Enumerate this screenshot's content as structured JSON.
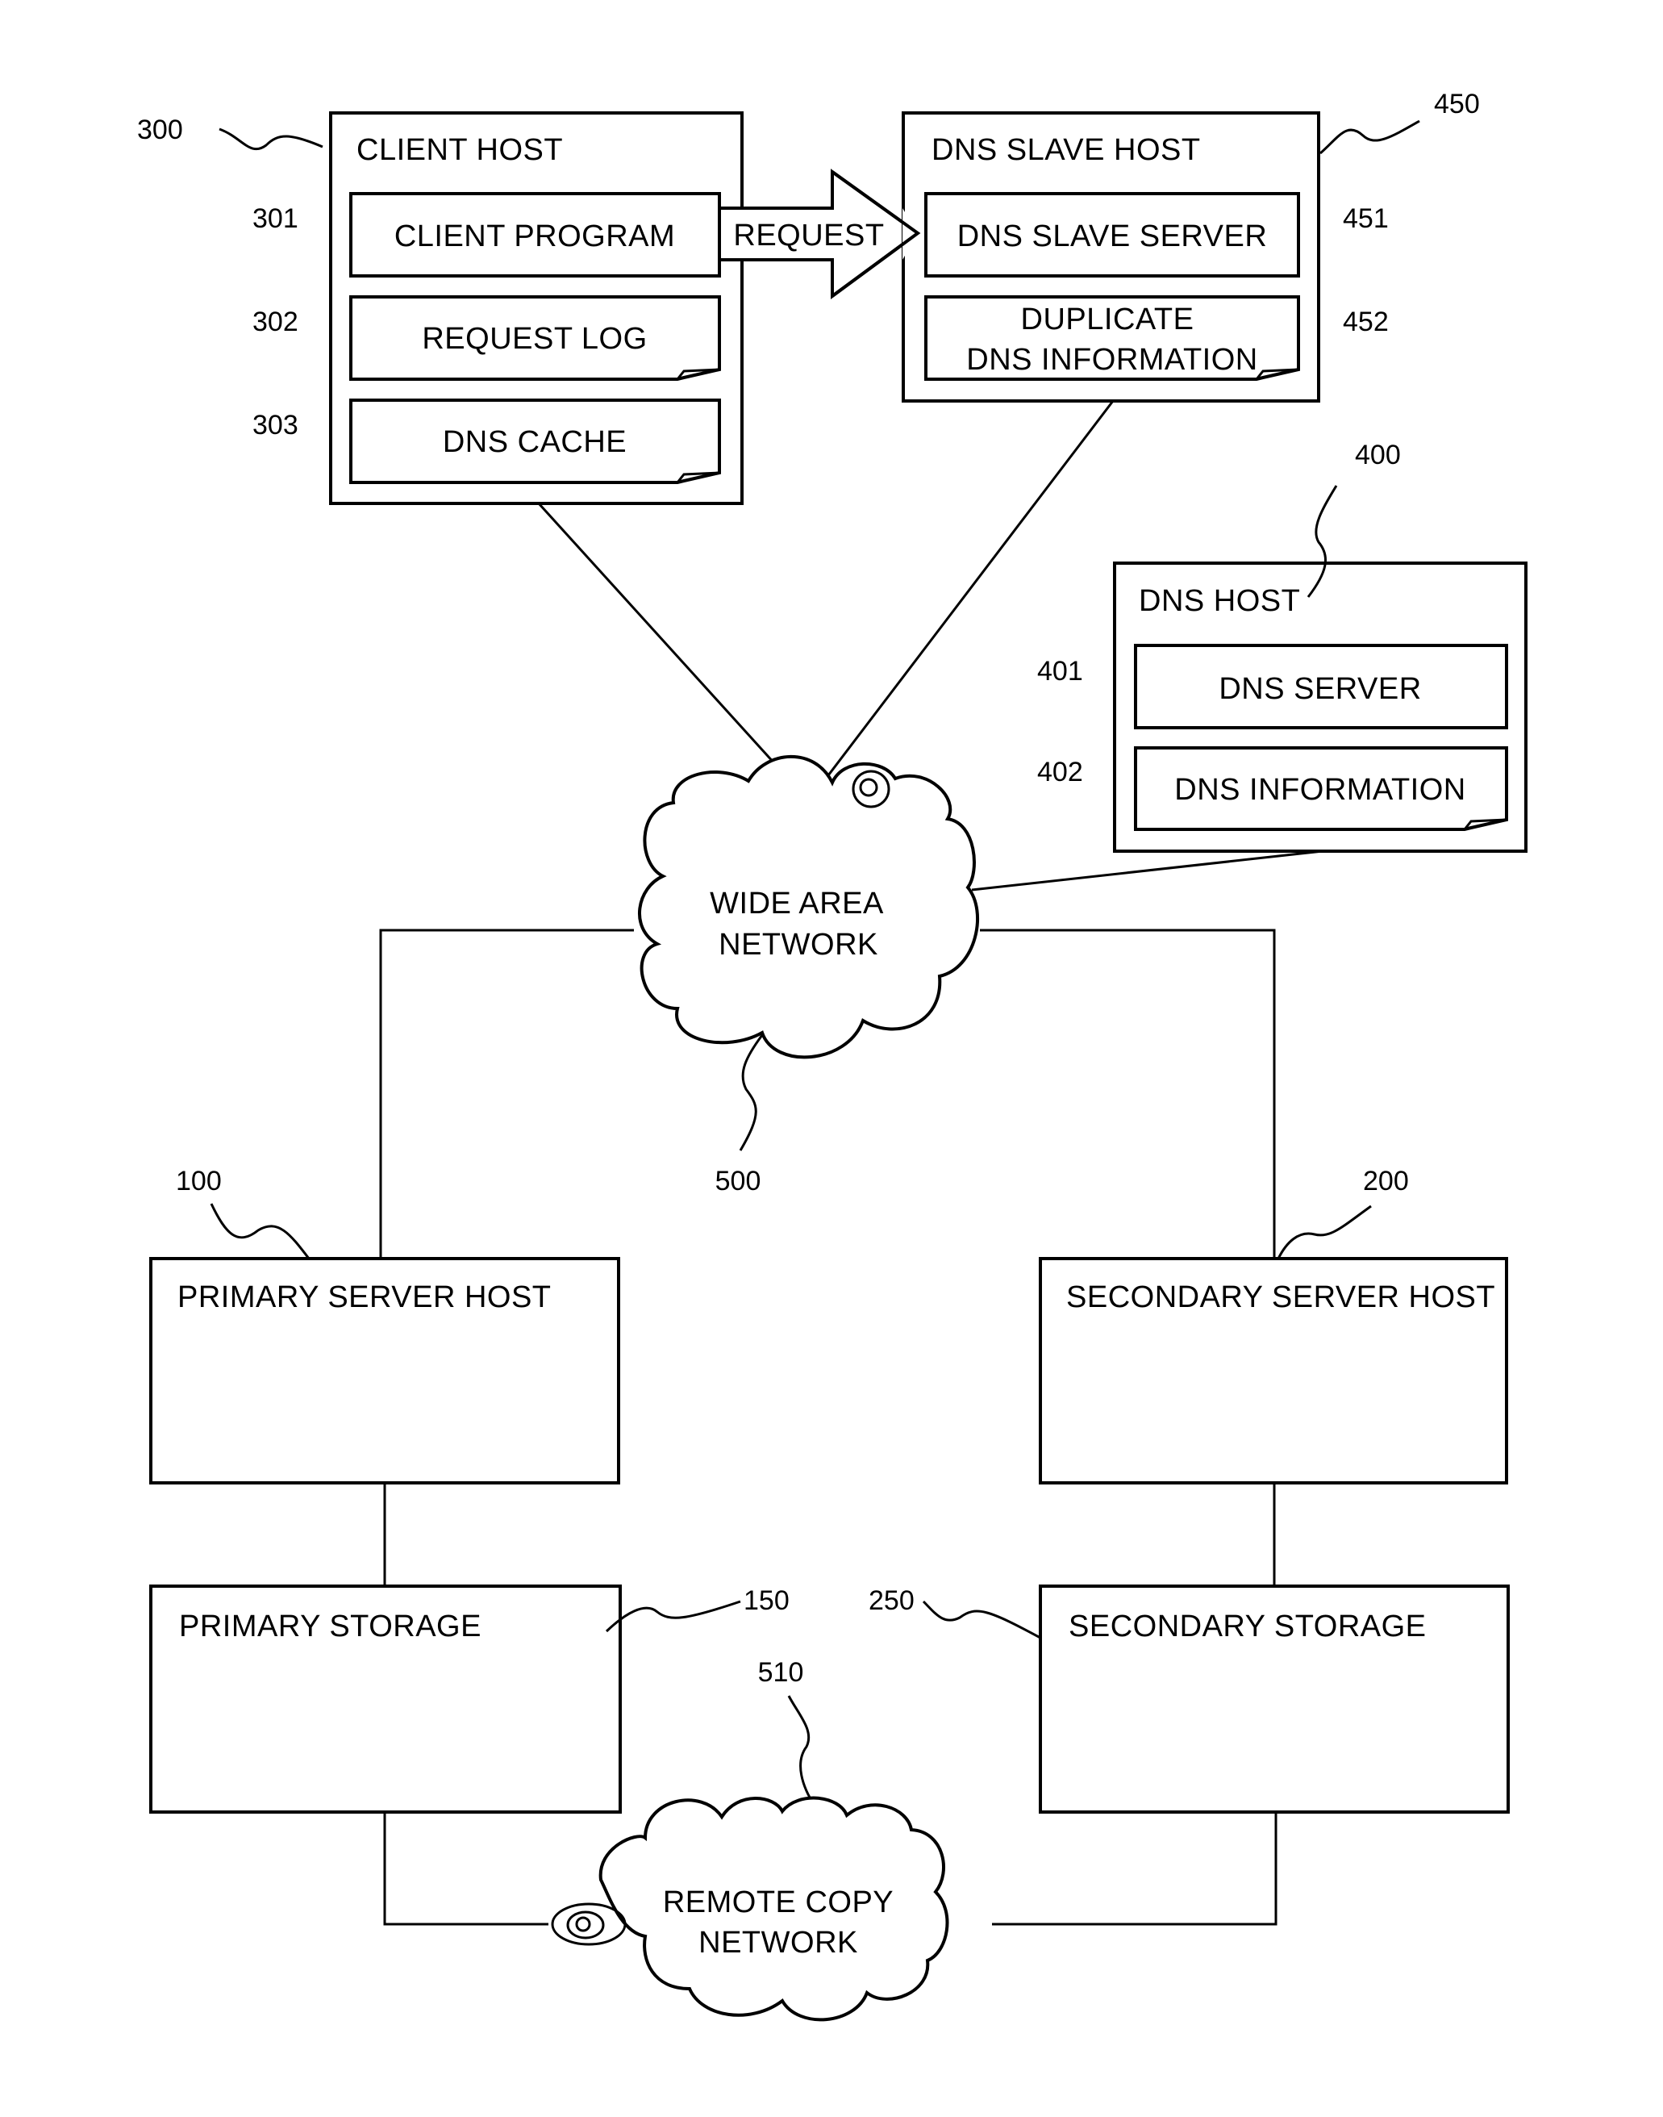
{
  "nodes": {
    "client_host": {
      "ref": "300",
      "title": "CLIENT HOST",
      "children": [
        {
          "ref": "301",
          "label": "CLIENT PROGRAM"
        },
        {
          "ref": "302",
          "label": "REQUEST LOG"
        },
        {
          "ref": "303",
          "label": "DNS CACHE"
        }
      ]
    },
    "dns_slave_host": {
      "ref": "450",
      "title": "DNS SLAVE HOST",
      "children": [
        {
          "ref": "451",
          "label": "DNS SLAVE SERVER"
        },
        {
          "ref": "452",
          "label_line1": "DUPLICATE",
          "label_line2": "DNS INFORMATION"
        }
      ]
    },
    "dns_host": {
      "ref": "400",
      "title": "DNS HOST",
      "children": [
        {
          "ref": "401",
          "label": "DNS SERVER"
        },
        {
          "ref": "402",
          "label": "DNS INFORMATION"
        }
      ]
    },
    "wan": {
      "ref": "500",
      "line1": "WIDE AREA",
      "line2": "NETWORK"
    },
    "primary_server_host": {
      "ref": "100",
      "title": "PRIMARY SERVER HOST"
    },
    "secondary_server_host": {
      "ref": "200",
      "title": "SECONDARY SERVER HOST"
    },
    "primary_storage": {
      "ref": "150",
      "title": "PRIMARY STORAGE"
    },
    "secondary_storage": {
      "ref": "250",
      "title": "SECONDARY STORAGE"
    },
    "remote_copy_network": {
      "ref": "510",
      "line1": "REMOTE COPY",
      "line2": "NETWORK"
    }
  },
  "arrow": {
    "label": "REQUEST"
  }
}
